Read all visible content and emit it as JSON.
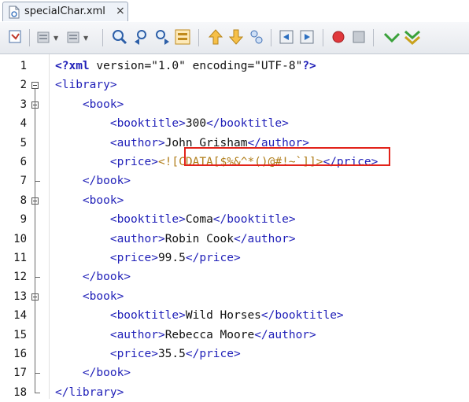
{
  "tab": {
    "title": "specialChar.xml",
    "close": "×"
  },
  "toolbar": {
    "buttons": [
      "source-history-icon",
      "back-icon",
      "forward-icon",
      "find-icon",
      "find-previous-icon",
      "find-next-icon",
      "toggle-highlight-icon",
      "previous-bookmark-icon",
      "next-bookmark-icon",
      "toggle-bookmark-icon",
      "shift-left-icon",
      "shift-right-icon",
      "start-macro-icon",
      "stop-macro-icon",
      "check-xml-icon",
      "validate-xml-icon"
    ]
  },
  "editor": {
    "line_numbers": [
      "1",
      "2",
      "3",
      "4",
      "5",
      "6",
      "7",
      "8",
      "9",
      "10",
      "11",
      "12",
      "13",
      "14",
      "15",
      "16",
      "17",
      "18"
    ],
    "lines": [
      {
        "indent": "",
        "parts": [
          {
            "t": "pi",
            "v": "<?xml"
          },
          {
            "t": "attr",
            "v": " version="
          },
          {
            "t": "str",
            "v": "\"1.0\""
          },
          {
            "t": "attr",
            "v": " encoding="
          },
          {
            "t": "str",
            "v": "\"UTF-8\""
          },
          {
            "t": "pi",
            "v": "?>"
          }
        ]
      },
      {
        "indent": "",
        "parts": [
          {
            "t": "tag",
            "v": "<library>"
          }
        ]
      },
      {
        "indent": "    ",
        "parts": [
          {
            "t": "tag",
            "v": "<book>"
          }
        ]
      },
      {
        "indent": "        ",
        "parts": [
          {
            "t": "tag",
            "v": "<booktitle>"
          },
          {
            "t": "text",
            "v": "300"
          },
          {
            "t": "tag",
            "v": "</booktitle>"
          }
        ]
      },
      {
        "indent": "        ",
        "parts": [
          {
            "t": "tag",
            "v": "<author>"
          },
          {
            "t": "text",
            "v": "John Grisham"
          },
          {
            "t": "tag",
            "v": "</author>"
          }
        ]
      },
      {
        "indent": "        ",
        "parts": [
          {
            "t": "tag",
            "v": "<price>"
          },
          {
            "t": "cdata",
            "v": "<![CDATA[$%&^*()@#!~`]]>"
          },
          {
            "t": "tag",
            "v": "</price>"
          }
        ]
      },
      {
        "indent": "    ",
        "parts": [
          {
            "t": "tag",
            "v": "</book>"
          }
        ]
      },
      {
        "indent": "    ",
        "parts": [
          {
            "t": "tag",
            "v": "<book>"
          }
        ]
      },
      {
        "indent": "        ",
        "parts": [
          {
            "t": "tag",
            "v": "<booktitle>"
          },
          {
            "t": "text",
            "v": "Coma"
          },
          {
            "t": "tag",
            "v": "</booktitle>"
          }
        ]
      },
      {
        "indent": "        ",
        "parts": [
          {
            "t": "tag",
            "v": "<author>"
          },
          {
            "t": "text",
            "v": "Robin Cook"
          },
          {
            "t": "tag",
            "v": "</author>"
          }
        ]
      },
      {
        "indent": "        ",
        "parts": [
          {
            "t": "tag",
            "v": "<price>"
          },
          {
            "t": "text",
            "v": "99.5"
          },
          {
            "t": "tag",
            "v": "</price>"
          }
        ]
      },
      {
        "indent": "    ",
        "parts": [
          {
            "t": "tag",
            "v": "</book>"
          }
        ]
      },
      {
        "indent": "    ",
        "parts": [
          {
            "t": "tag",
            "v": "<book>"
          }
        ]
      },
      {
        "indent": "        ",
        "parts": [
          {
            "t": "tag",
            "v": "<booktitle>"
          },
          {
            "t": "text",
            "v": "Wild Horses"
          },
          {
            "t": "tag",
            "v": "</booktitle>"
          }
        ]
      },
      {
        "indent": "        ",
        "parts": [
          {
            "t": "tag",
            "v": "<author>"
          },
          {
            "t": "text",
            "v": "Rebecca Moore"
          },
          {
            "t": "tag",
            "v": "</author>"
          }
        ]
      },
      {
        "indent": "        ",
        "parts": [
          {
            "t": "tag",
            "v": "<price>"
          },
          {
            "t": "text",
            "v": "35.5"
          },
          {
            "t": "tag",
            "v": "</price>"
          }
        ]
      },
      {
        "indent": "    ",
        "parts": [
          {
            "t": "tag",
            "v": "</book>"
          }
        ]
      },
      {
        "indent": "",
        "parts": [
          {
            "t": "tag",
            "v": "</library>"
          }
        ]
      }
    ]
  },
  "colors": {
    "tag": "#1f1fb8",
    "text": "#111111",
    "cdata": "#b07d1a",
    "highlight_border": "#e2231a"
  }
}
